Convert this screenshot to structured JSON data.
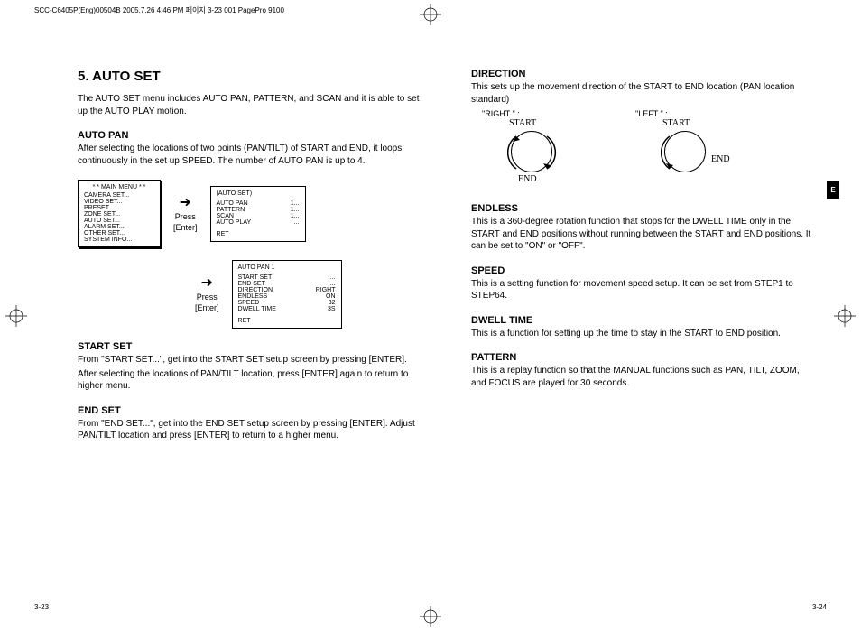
{
  "header": "SCC-C6405P(Eng)00504B  2005.7.26 4:46 PM  페이지 3-23   001 PagePro 9100",
  "folio_left": "3-23",
  "folio_right": "3-24",
  "tab": "E",
  "left": {
    "h1": "5. AUTO SET",
    "intro": "The AUTO SET menu includes AUTO PAN, PATTERN, and SCAN and it is able to set up the AUTO PLAY motion.",
    "auto_pan_h": "AUTO PAN",
    "auto_pan_p": "After selecting the locations of two points (PAN/TILT) of START and END, it loops continuously in the set up SPEED. The number of AUTO PAN is up to 4.",
    "press": "Press",
    "enter": "[Enter]",
    "menu1": {
      "title": "* * MAIN MENU * *",
      "items": [
        "CAMERA SET...",
        "VIDEO SET...",
        "PRESET...",
        "ZONE SET...",
        "AUTO SET...",
        "ALARM SET...",
        "OTHER SET...",
        "SYSTEM INFO..."
      ]
    },
    "menu2": {
      "title": "(AUTO SET)",
      "rows": [
        [
          "AUTO PAN",
          "1..."
        ],
        [
          "PATTERN",
          "1..."
        ],
        [
          "SCAN",
          "1..."
        ],
        [
          "AUTO PLAY",
          "..."
        ]
      ],
      "ret": "RET"
    },
    "menu3": {
      "title": "AUTO PAN   1",
      "rows": [
        [
          "START SET",
          "..."
        ],
        [
          "END SET",
          "..."
        ],
        [
          "DIRECTION",
          "RIGHT"
        ],
        [
          "ENDLESS",
          "ON"
        ],
        [
          "SPEED",
          "32"
        ],
        [
          "DWELL TIME",
          "3S"
        ]
      ],
      "ret": "RET"
    },
    "start_set_h": "START SET",
    "start_set_p1": "From \"START SET...\", get into the START SET setup screen by pressing [ENTER].",
    "start_set_p2": "After selecting the locations of PAN/TILT location, press [ENTER] again to return to higher menu.",
    "end_set_h": "END SET",
    "end_set_p": "From \"END SET...\", get into the END SET setup screen by pressing [ENTER].  Adjust PAN/TILT location and press [ENTER] to return to a higher menu."
  },
  "right": {
    "direction_h": "DIRECTION",
    "direction_p1": "This sets up the movement direction of the START to END location (PAN location standard)",
    "right_lbl": "\"RIGHT \" :",
    "left_lbl": "\"LEFT \" :",
    "start": "START",
    "end": "END",
    "endless_h": "ENDLESS",
    "endless_p": "This is a 360-degree rotation function that stops for the DWELL TIME only in the START and END positions without running between the START and END positions.  It can be set to \"ON\" or \"OFF\".",
    "speed_h": "SPEED",
    "speed_p": "This is a setting function for movement speed setup.  It can be set from STEP1 to STEP64.",
    "dwell_h": "DWELL TIME",
    "dwell_p": "This is a function for setting up the time to stay in the START to END position.",
    "pattern_h": "PATTERN",
    "pattern_p": "This is a replay function so that the MANUAL functions such as PAN, TILT, ZOOM, and FOCUS are played for 30 seconds."
  }
}
